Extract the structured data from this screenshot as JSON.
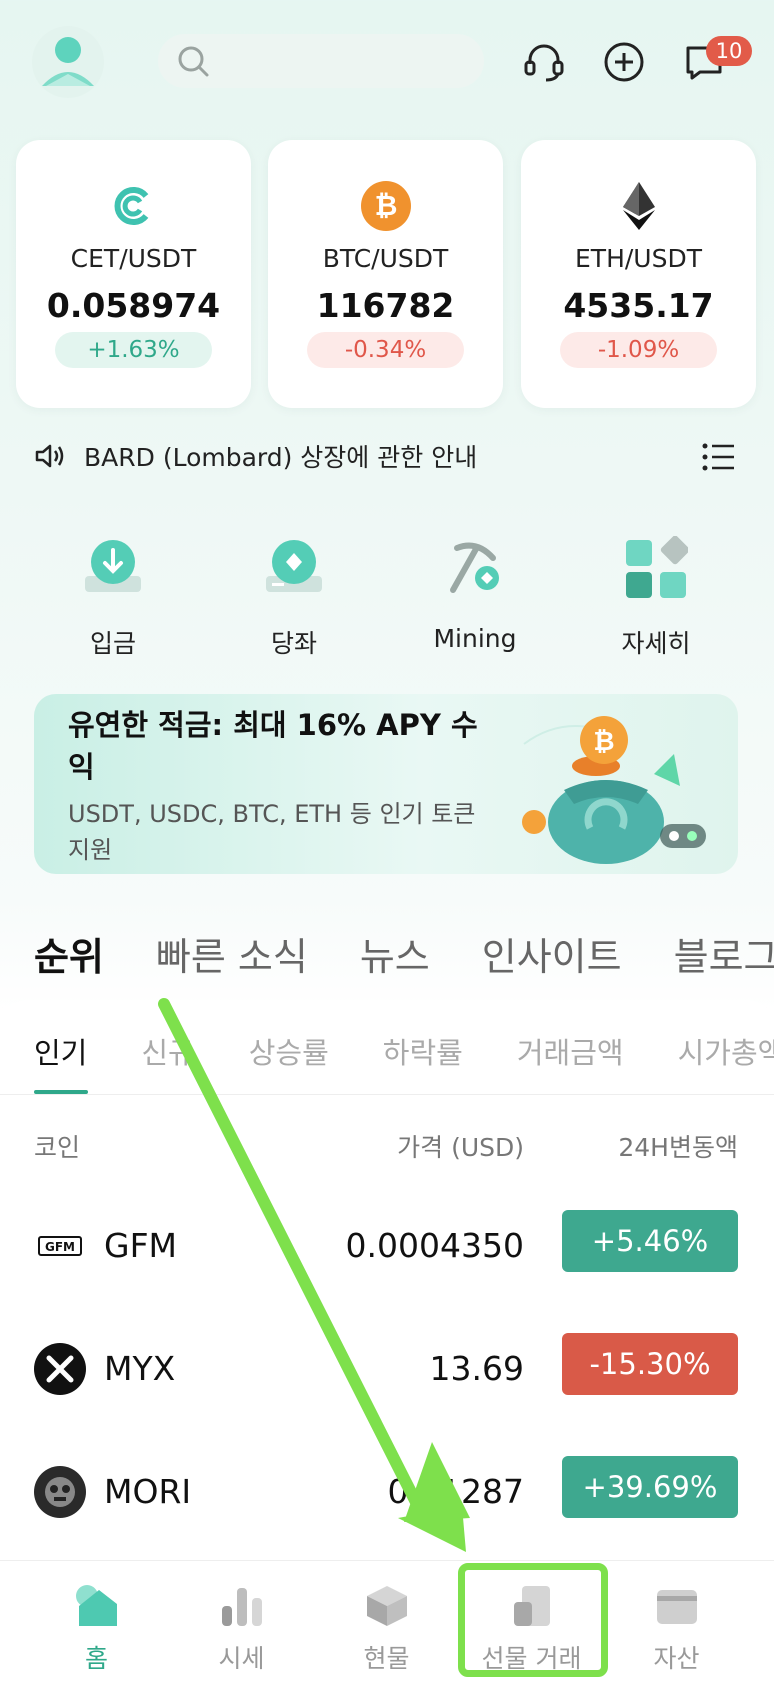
{
  "header": {
    "icons": [
      "avatar-icon",
      "search-icon",
      "headset-icon",
      "add-circle-icon",
      "message-icon"
    ],
    "message_badge": "10"
  },
  "tickers": [
    {
      "pair": "CET/USDT",
      "price": "0.058974",
      "change": "+1.63%",
      "dir": "up",
      "icon": "cet-icon"
    },
    {
      "pair": "BTC/USDT",
      "price": "116782",
      "change": "-0.34%",
      "dir": "down",
      "icon": "btc-icon"
    },
    {
      "pair": "ETH/USDT",
      "price": "4535.17",
      "change": "-1.09%",
      "dir": "down",
      "icon": "eth-icon"
    }
  ],
  "notice": {
    "text": "BARD (Lombard) 상장에 관한 안내"
  },
  "quick_actions": [
    {
      "label": "입금"
    },
    {
      "label": "당좌"
    },
    {
      "label": "Mining"
    },
    {
      "label": "자세히"
    }
  ],
  "banner": {
    "title": "유연한 적금: 최대 16% APY 수익",
    "subtitle": "USDT, USDC, BTC, ETH 등 인기 토큰 지원"
  },
  "section_tabs": [
    "순위",
    "빠른 소식",
    "뉴스",
    "인사이트",
    "블로그"
  ],
  "sub_tabs": [
    "인기",
    "신규",
    "상승률",
    "하락률",
    "거래금액",
    "시가총액"
  ],
  "columns": {
    "coin": "코인",
    "price": "가격 (USD)",
    "change": "24H변동액"
  },
  "rows": [
    {
      "name": "GFM",
      "price": "0.0004350",
      "change": "+5.46%",
      "dir": "up"
    },
    {
      "name": "MYX",
      "price": "13.69",
      "change": "-15.30%",
      "dir": "down"
    },
    {
      "name": "MORI",
      "price": "0.01287",
      "change": "+39.69%",
      "dir": "up"
    }
  ],
  "bottom_nav": [
    {
      "label": "홈",
      "active": true
    },
    {
      "label": "시세"
    },
    {
      "label": "현물"
    },
    {
      "label": "선물 거래"
    },
    {
      "label": "자산"
    }
  ],
  "colors": {
    "accent": "#2fa88a",
    "up": "#3ea88f",
    "down": "#d95a48",
    "annotation": "#7ee04c"
  }
}
